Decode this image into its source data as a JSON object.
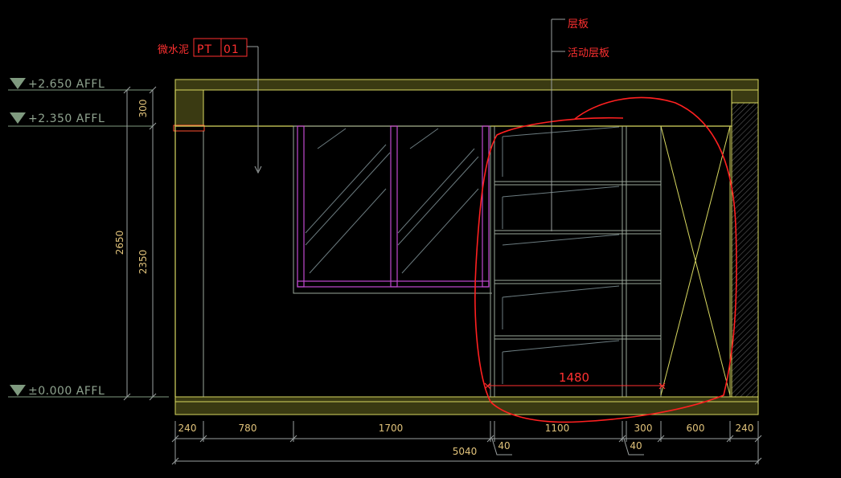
{
  "levels": [
    {
      "label": "+2.650  AFFL"
    },
    {
      "label": "+2.350  AFFL"
    },
    {
      "label": "±0.000  AFFL"
    }
  ],
  "vertical_dims": {
    "total": "2650",
    "lower": "2350",
    "upper": "300"
  },
  "bottom_dims": [
    "240",
    "780",
    "1700",
    "1100",
    "300",
    "600",
    "240"
  ],
  "offset_dims": [
    "40",
    "40"
  ],
  "total_width": "5040",
  "annotations": {
    "material": "微水泥",
    "code_prefix": "PT",
    "code_number": "01",
    "shelf": "层板",
    "movable_shelf": "活动层板",
    "width_mark": "1480"
  },
  "colors": {
    "background": "#000000",
    "structure": "#d8d860",
    "cabinet": "#9aa89a",
    "window": "#c04ad0",
    "dimension": "#9aa0a0",
    "markup": "#ff2020",
    "hatch": "#606060"
  }
}
